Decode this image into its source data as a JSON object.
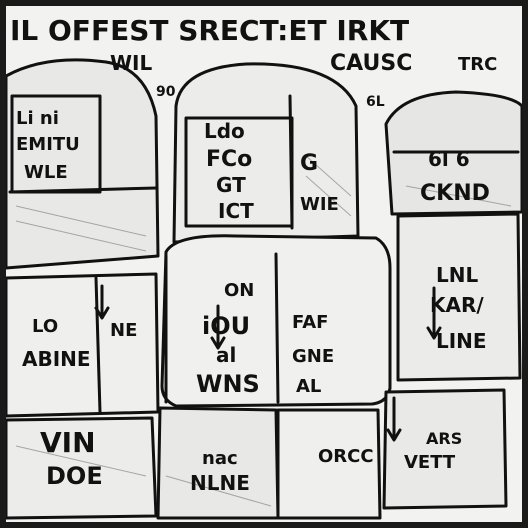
{
  "top_lettering": {
    "line1": "IL OFFEST SRECT:ET IRKT",
    "line2_left": "WIL",
    "line2_mid": "CAUSC",
    "line2_right": "TRC",
    "small_a": "90",
    "small_b": "6L"
  },
  "boxes": [
    {
      "name": "box-top-left",
      "lines": [
        "Li ni",
        "EMITU",
        "WLE"
      ]
    },
    {
      "name": "box-top-center",
      "lines": [
        "Ldo",
        "FCo",
        "GT",
        "ICT"
      ],
      "side": [
        "G",
        "WIE"
      ]
    },
    {
      "name": "box-top-right",
      "lines": [
        "6l 6",
        "CKND"
      ]
    },
    {
      "name": "box-mid-left",
      "lines": [
        "LO",
        "ABINE"
      ],
      "side": [
        "NE"
      ]
    },
    {
      "name": "box-mid-center",
      "lines": [
        "ON",
        "iOU",
        "al",
        "WNS"
      ],
      "side": [
        "FAF",
        "GNE",
        "AL"
      ]
    },
    {
      "name": "box-mid-right",
      "lines": [
        "LNL",
        "KAR/",
        "LINE"
      ]
    },
    {
      "name": "box-bottom-left",
      "lines": [
        "VIN",
        "DOE"
      ]
    },
    {
      "name": "box-bottom-center",
      "lines": [
        "nac",
        "NLNE"
      ]
    },
    {
      "name": "box-bottom-mid",
      "lines": [
        "ORCC"
      ]
    },
    {
      "name": "box-bottom-right",
      "lines": [
        "ARS",
        "VETT"
      ]
    }
  ]
}
